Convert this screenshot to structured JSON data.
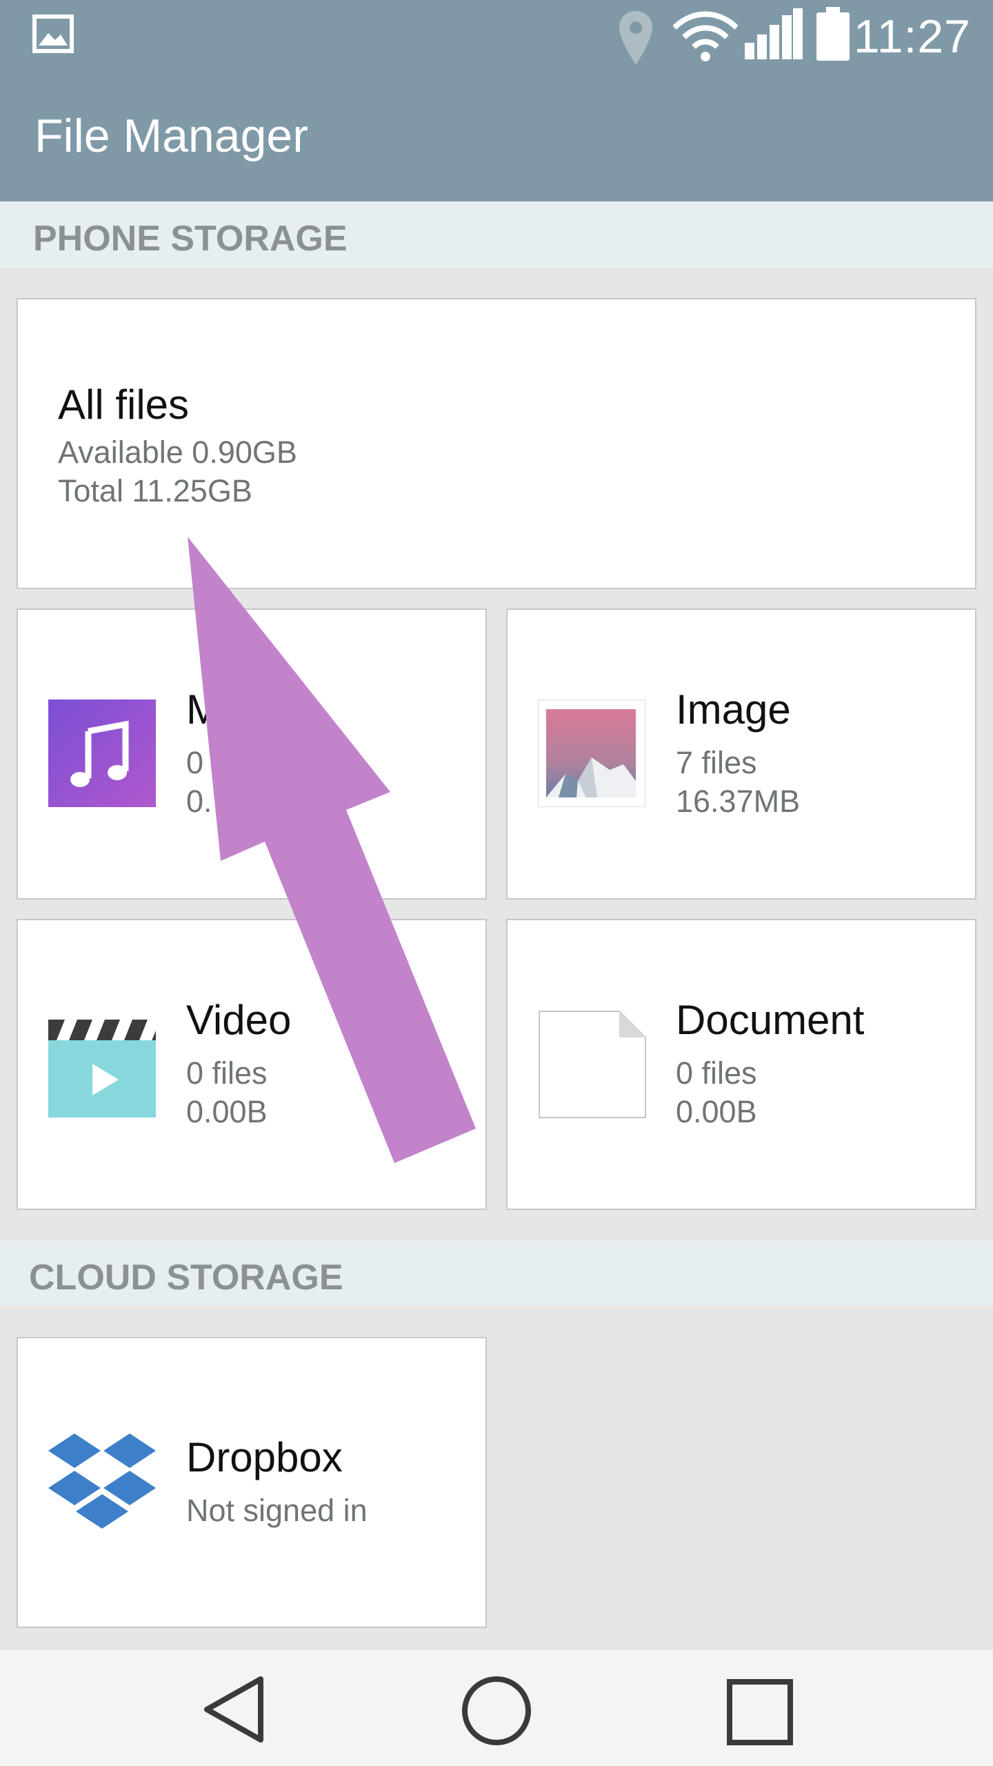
{
  "status_bar": {
    "time": "11:27",
    "icons": [
      "image-notification-icon",
      "location-icon",
      "wifi-icon",
      "signal-icon",
      "battery-icon"
    ]
  },
  "app_bar": {
    "title": "File Manager"
  },
  "phone_storage": {
    "header": "PHONE STORAGE",
    "all_files": {
      "name": "All files",
      "available": "Available 0.90GB",
      "total": "Total 11.25GB"
    },
    "music": {
      "name": "M",
      "files": "0",
      "size": "0.",
      "icon": "music-note-icon"
    },
    "image": {
      "name": "Image",
      "files": "7 files",
      "size": "16.37MB",
      "icon": "mountain-image-icon"
    },
    "video": {
      "name": "Video",
      "files": "0 files",
      "size": "0.00B",
      "icon": "clapperboard-icon"
    },
    "document": {
      "name": "Document",
      "files": "0 files",
      "size": "0.00B",
      "icon": "document-icon"
    }
  },
  "cloud_storage": {
    "header": "CLOUD STORAGE",
    "dropbox": {
      "name": "Dropbox",
      "status": "Not signed in",
      "icon": "dropbox-icon"
    }
  },
  "nav_bar": {
    "icons": [
      "back-icon",
      "home-icon",
      "recents-icon"
    ]
  },
  "colors": {
    "bar": "#7f99a7",
    "arrow": "#c283cb",
    "dropbox": "#3d7fc9"
  }
}
